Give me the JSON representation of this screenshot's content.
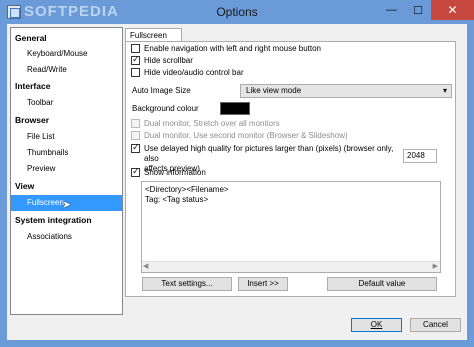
{
  "window": {
    "title": "Options",
    "watermark": "SOFTPEDIA",
    "controls": {
      "minimize": "—",
      "maximize": "☐",
      "close": "✕"
    }
  },
  "tree": {
    "items": [
      {
        "label": "General",
        "level": 0,
        "selected": false
      },
      {
        "label": "Keyboard/Mouse",
        "level": 1,
        "selected": false
      },
      {
        "label": "Read/Write",
        "level": 1,
        "selected": false
      },
      {
        "label": "Interface",
        "level": 0,
        "selected": false
      },
      {
        "label": "Toolbar",
        "level": 1,
        "selected": false
      },
      {
        "label": "Browser",
        "level": 0,
        "selected": false
      },
      {
        "label": "File List",
        "level": 1,
        "selected": false
      },
      {
        "label": "Thumbnails",
        "level": 1,
        "selected": false
      },
      {
        "label": "Preview",
        "level": 1,
        "selected": false
      },
      {
        "label": "View",
        "level": 0,
        "selected": false
      },
      {
        "label": "Fullscreen",
        "level": 1,
        "selected": true
      },
      {
        "label": "System integration",
        "level": 0,
        "selected": false
      },
      {
        "label": "Associations",
        "level": 1,
        "selected": false
      }
    ]
  },
  "tab": {
    "label": "Fullscreen"
  },
  "options": {
    "enable_navigation": {
      "label": "Enable navigation with left and right mouse button",
      "checked": false
    },
    "hide_scrollbar": {
      "label": "Hide scrollbar",
      "checked": true
    },
    "hide_video_bar": {
      "label": "Hide video/audio control bar",
      "checked": false
    },
    "auto_image_size": {
      "label": "Auto Image Size",
      "value": "Like view mode"
    },
    "background_colour": {
      "label": "Background colour",
      "color": "#000000"
    },
    "dual_stretch": {
      "label": "Dual monitor, Stretch over all monitors",
      "checked": false,
      "disabled": true
    },
    "dual_second": {
      "label": "Dual monitor, Use second monitor (Browser & Slideshow)",
      "checked": false,
      "disabled": true
    },
    "delayed_hq": {
      "label": "Use delayed high quality for pictures larger than (pixels) (browser only, also",
      "label2": "affects preview)",
      "checked": true,
      "value": "2048"
    },
    "show_information": {
      "label": "Show information",
      "checked": true
    },
    "info_text": {
      "line1": "<Directory><Filename>",
      "line2": "Tag: <Tag status>"
    }
  },
  "buttons": {
    "text_settings": "Text settings...",
    "insert": "Insert >>",
    "default_value": "Default value",
    "ok": "OK",
    "cancel": "Cancel"
  },
  "colors": {
    "titlebar": "#6a9bd8",
    "selection": "#3399ff",
    "close": "#c7483f"
  }
}
